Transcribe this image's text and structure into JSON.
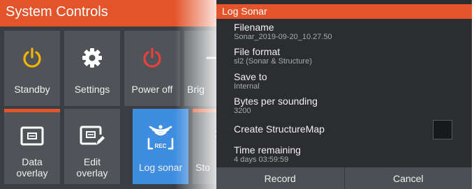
{
  "system_controls": {
    "title": "System Controls",
    "tiles": [
      {
        "label": "Standby",
        "icon": "power-standby-icon"
      },
      {
        "label": "Settings",
        "icon": "gear-icon"
      },
      {
        "label": "Power off",
        "icon": "power-off-icon"
      },
      {
        "label": "Brig",
        "icon": "brightness-icon"
      },
      {
        "label": "Data\noverlay",
        "icon": "data-overlay-icon"
      },
      {
        "label": "Edit\noverlay",
        "icon": "edit-overlay-icon"
      },
      {
        "label": "Log sonar",
        "icon": "log-sonar-icon",
        "icon_text": "REC"
      },
      {
        "label": "Sto",
        "icon": "store-icon"
      }
    ]
  },
  "log_sonar": {
    "title": "Log Sonar",
    "filename": {
      "label": "Filename",
      "value": "Sonar_2019-09-20_10.27.50"
    },
    "file_format": {
      "label": "File format",
      "value": "sl2 (Sonar & Structure)"
    },
    "save_to": {
      "label": "Save to",
      "value": "Internal"
    },
    "bytes_per_sounding": {
      "label": "Bytes per sounding",
      "value": "3200"
    },
    "create_structuremap": {
      "label": "Create StructureMap",
      "checked": false
    },
    "time_remaining": {
      "label": "Time remaining",
      "value": "4 days 03:59:59"
    },
    "record_label": "Record",
    "cancel_label": "Cancel"
  },
  "colors": {
    "accent": "#e4542a",
    "tile": "#505459",
    "active_tile": "#3e8de0",
    "standby_icon": "#f5b400",
    "power_off_icon": "#e8403a"
  }
}
